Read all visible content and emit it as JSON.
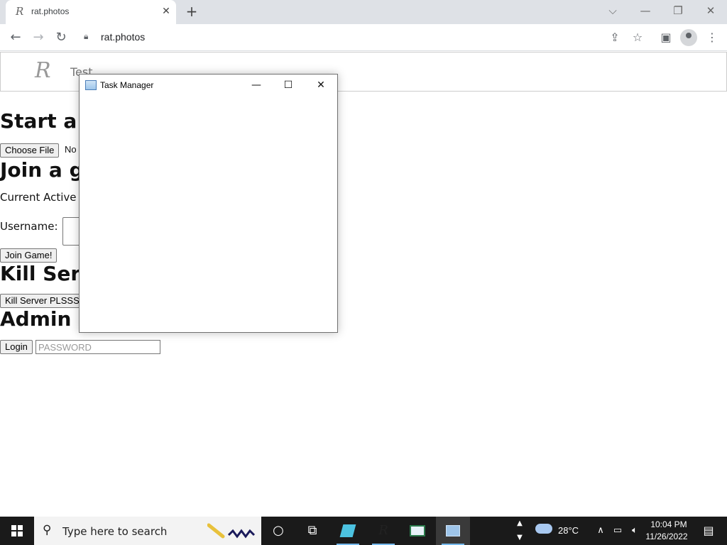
{
  "browser": {
    "tab_title": "rat.photos",
    "tab_favicon": "R",
    "url": "rat.photos"
  },
  "site": {
    "logo": "R",
    "nav_test": "Test"
  },
  "page": {
    "heading_start": "Start a",
    "choose_file_label": "Choose File",
    "no_file_text": "No",
    "heading_join": "Join a g",
    "current_active": "Current Active",
    "username_label": "Username:",
    "join_button": "Join Game!",
    "heading_kill": "Kill Serv",
    "kill_button": "Kill Server PLSSS",
    "heading_admin": "Admin Pa",
    "login_button": "Login",
    "password_placeholder": "PASSWORD"
  },
  "task_manager": {
    "title": "Task Manager"
  },
  "taskbar": {
    "search_placeholder": "Type here to search",
    "weather_temp": "28°C",
    "clock_time": "10:04 PM",
    "clock_date": "11/26/2022"
  },
  "icons": {
    "back": "back-arrow-icon",
    "forward": "forward-arrow-icon",
    "reload": "reload-icon",
    "lock": "lock-icon",
    "share": "share-icon",
    "star": "star-icon",
    "sidepanel": "side-panel-icon",
    "profile": "profile-icon",
    "menu": "kebab-menu-icon"
  },
  "colors": {
    "tabbar_bg": "#dee1e6",
    "taskbar_bg": "#1a1a1a",
    "accent": "#76b9ed"
  }
}
